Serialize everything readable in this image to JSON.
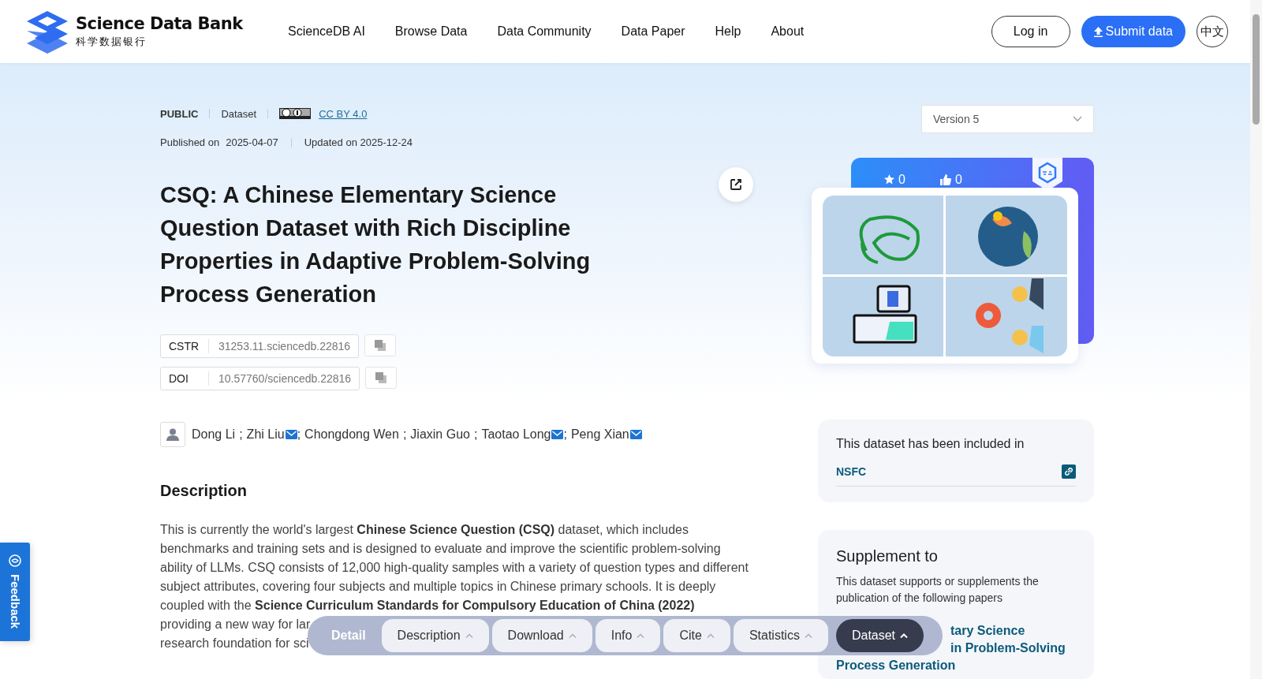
{
  "header": {
    "logo_title": "Science Data Bank",
    "logo_subtitle": "科学数据银行",
    "nav": [
      "ScienceDB AI",
      "Browse Data",
      "Data Community",
      "Data Paper",
      "Help",
      "About"
    ],
    "login": "Log in",
    "submit": "Submit data",
    "language": "中文"
  },
  "dataset": {
    "access": "PUBLIC",
    "type": "Dataset",
    "license": "CC BY 4.0",
    "published_label": "Published on",
    "published": "2025-04-07",
    "updated": "Updated on 2025-12-24",
    "title": "CSQ: A Chinese Elementary Science Question Dataset with Rich Discipline Properties in Adaptive Problem-Solving Process Generation",
    "identifiers": [
      {
        "label": "CSTR",
        "value": "31253.11.sciencedb.22816"
      },
      {
        "label": "DOI",
        "value": "10.57760/sciencedb.22816"
      }
    ],
    "separator": ";",
    "authors": [
      {
        "name": "Dong Li",
        "email": false
      },
      {
        "name": "Zhi Liu",
        "email": true
      },
      {
        "name": "Chongdong Wen",
        "email": false
      },
      {
        "name": "Jiaxin Guo",
        "email": false
      },
      {
        "name": "Taotao Long",
        "email": true
      },
      {
        "name": "Peng Xian",
        "email": true
      }
    ]
  },
  "description": {
    "heading": "Description",
    "lines": [
      "This is currently the world's largest **Chinese Science Question (CSQ)** dataset, which includes",
      "benchmarks and training sets and is designed to evaluate and improve the scientific problem-solving",
      "ability of LLMs. CSQ consists of 12,000 high-quality samples with a variety of question types and different",
      "subject attributes, covering four subjects and multiple topics in Chinese primary schools. It is deeply",
      "coupled with the **Science Curriculum Standards for Compulsory Education of China (2022)**",
      "providing a new way for lar",
      "research foundation for sci"
    ]
  },
  "sidebar": {
    "version": "Version 5",
    "stars": "0",
    "likes": "0",
    "included": {
      "heading": "This dataset has been included in",
      "items": [
        "NSFC"
      ]
    },
    "supplement": {
      "heading": "Supplement to",
      "text": "This dataset supports or supplements the publication of the following papers",
      "paper_lines": [
        "tary Science",
        "in Problem-Solving",
        "Process Generation"
      ]
    }
  },
  "feedback": "Feedback",
  "section_nav": {
    "label": "Detail",
    "items": [
      {
        "label": "Description",
        "selected": false
      },
      {
        "label": "Download",
        "selected": false
      },
      {
        "label": "Info",
        "selected": false
      },
      {
        "label": "Cite",
        "selected": false
      },
      {
        "label": "Statistics",
        "selected": false
      },
      {
        "label": "Dataset",
        "selected": true
      }
    ]
  }
}
